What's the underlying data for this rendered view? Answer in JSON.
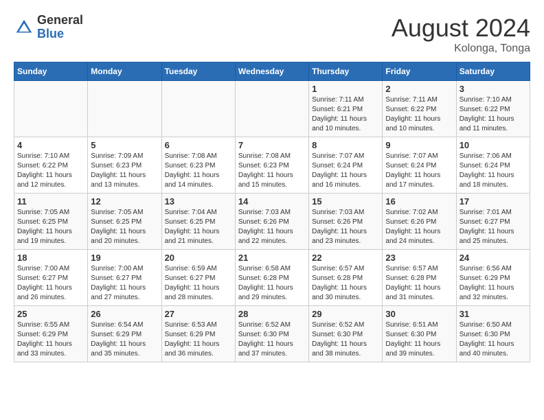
{
  "logo": {
    "general": "General",
    "blue": "Blue"
  },
  "title": "August 2024",
  "subtitle": "Kolonga, Tonga",
  "headers": [
    "Sunday",
    "Monday",
    "Tuesday",
    "Wednesday",
    "Thursday",
    "Friday",
    "Saturday"
  ],
  "weeks": [
    [
      {
        "day": "",
        "info": ""
      },
      {
        "day": "",
        "info": ""
      },
      {
        "day": "",
        "info": ""
      },
      {
        "day": "",
        "info": ""
      },
      {
        "day": "1",
        "info": "Sunrise: 7:11 AM\nSunset: 6:21 PM\nDaylight: 11 hours\nand 10 minutes."
      },
      {
        "day": "2",
        "info": "Sunrise: 7:11 AM\nSunset: 6:22 PM\nDaylight: 11 hours\nand 10 minutes."
      },
      {
        "day": "3",
        "info": "Sunrise: 7:10 AM\nSunset: 6:22 PM\nDaylight: 11 hours\nand 11 minutes."
      }
    ],
    [
      {
        "day": "4",
        "info": "Sunrise: 7:10 AM\nSunset: 6:22 PM\nDaylight: 11 hours\nand 12 minutes."
      },
      {
        "day": "5",
        "info": "Sunrise: 7:09 AM\nSunset: 6:23 PM\nDaylight: 11 hours\nand 13 minutes."
      },
      {
        "day": "6",
        "info": "Sunrise: 7:08 AM\nSunset: 6:23 PM\nDaylight: 11 hours\nand 14 minutes."
      },
      {
        "day": "7",
        "info": "Sunrise: 7:08 AM\nSunset: 6:23 PM\nDaylight: 11 hours\nand 15 minutes."
      },
      {
        "day": "8",
        "info": "Sunrise: 7:07 AM\nSunset: 6:24 PM\nDaylight: 11 hours\nand 16 minutes."
      },
      {
        "day": "9",
        "info": "Sunrise: 7:07 AM\nSunset: 6:24 PM\nDaylight: 11 hours\nand 17 minutes."
      },
      {
        "day": "10",
        "info": "Sunrise: 7:06 AM\nSunset: 6:24 PM\nDaylight: 11 hours\nand 18 minutes."
      }
    ],
    [
      {
        "day": "11",
        "info": "Sunrise: 7:05 AM\nSunset: 6:25 PM\nDaylight: 11 hours\nand 19 minutes."
      },
      {
        "day": "12",
        "info": "Sunrise: 7:05 AM\nSunset: 6:25 PM\nDaylight: 11 hours\nand 20 minutes."
      },
      {
        "day": "13",
        "info": "Sunrise: 7:04 AM\nSunset: 6:25 PM\nDaylight: 11 hours\nand 21 minutes."
      },
      {
        "day": "14",
        "info": "Sunrise: 7:03 AM\nSunset: 6:26 PM\nDaylight: 11 hours\nand 22 minutes."
      },
      {
        "day": "15",
        "info": "Sunrise: 7:03 AM\nSunset: 6:26 PM\nDaylight: 11 hours\nand 23 minutes."
      },
      {
        "day": "16",
        "info": "Sunrise: 7:02 AM\nSunset: 6:26 PM\nDaylight: 11 hours\nand 24 minutes."
      },
      {
        "day": "17",
        "info": "Sunrise: 7:01 AM\nSunset: 6:27 PM\nDaylight: 11 hours\nand 25 minutes."
      }
    ],
    [
      {
        "day": "18",
        "info": "Sunrise: 7:00 AM\nSunset: 6:27 PM\nDaylight: 11 hours\nand 26 minutes."
      },
      {
        "day": "19",
        "info": "Sunrise: 7:00 AM\nSunset: 6:27 PM\nDaylight: 11 hours\nand 27 minutes."
      },
      {
        "day": "20",
        "info": "Sunrise: 6:59 AM\nSunset: 6:27 PM\nDaylight: 11 hours\nand 28 minutes."
      },
      {
        "day": "21",
        "info": "Sunrise: 6:58 AM\nSunset: 6:28 PM\nDaylight: 11 hours\nand 29 minutes."
      },
      {
        "day": "22",
        "info": "Sunrise: 6:57 AM\nSunset: 6:28 PM\nDaylight: 11 hours\nand 30 minutes."
      },
      {
        "day": "23",
        "info": "Sunrise: 6:57 AM\nSunset: 6:28 PM\nDaylight: 11 hours\nand 31 minutes."
      },
      {
        "day": "24",
        "info": "Sunrise: 6:56 AM\nSunset: 6:29 PM\nDaylight: 11 hours\nand 32 minutes."
      }
    ],
    [
      {
        "day": "25",
        "info": "Sunrise: 6:55 AM\nSunset: 6:29 PM\nDaylight: 11 hours\nand 33 minutes."
      },
      {
        "day": "26",
        "info": "Sunrise: 6:54 AM\nSunset: 6:29 PM\nDaylight: 11 hours\nand 35 minutes."
      },
      {
        "day": "27",
        "info": "Sunrise: 6:53 AM\nSunset: 6:29 PM\nDaylight: 11 hours\nand 36 minutes."
      },
      {
        "day": "28",
        "info": "Sunrise: 6:52 AM\nSunset: 6:30 PM\nDaylight: 11 hours\nand 37 minutes."
      },
      {
        "day": "29",
        "info": "Sunrise: 6:52 AM\nSunset: 6:30 PM\nDaylight: 11 hours\nand 38 minutes."
      },
      {
        "day": "30",
        "info": "Sunrise: 6:51 AM\nSunset: 6:30 PM\nDaylight: 11 hours\nand 39 minutes."
      },
      {
        "day": "31",
        "info": "Sunrise: 6:50 AM\nSunset: 6:30 PM\nDaylight: 11 hours\nand 40 minutes."
      }
    ]
  ]
}
